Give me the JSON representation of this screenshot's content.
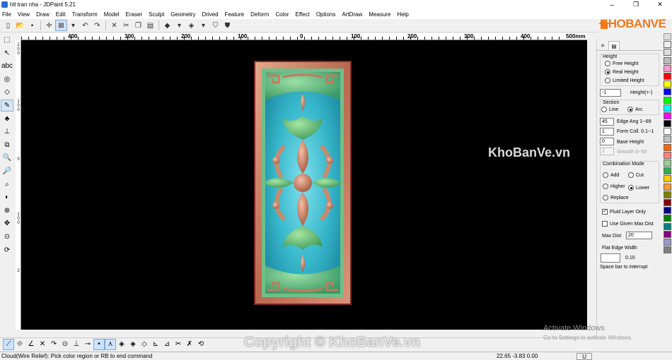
{
  "window": {
    "title": "hlt tran nha - JDPaint 5.21",
    "minimize": "─",
    "restore": "❐",
    "close": "✕"
  },
  "menu": [
    "File",
    "View",
    "Draw",
    "Edit",
    "Transform",
    "Model",
    "Eraser",
    "Sculpt",
    "Geometry",
    "Drived",
    "Feature",
    "Deform",
    "Color",
    "Effect",
    "Options",
    "ArtDraw",
    "Measure",
    "Help"
  ],
  "logo": {
    "text": "KHOBANVE"
  },
  "ruler": {
    "labels": [
      "400",
      "300",
      "200",
      "100",
      "0",
      "100",
      "200",
      "300",
      "400"
    ],
    "unit_label": "500mm"
  },
  "ruler_v": [
    "2",
    "0",
    "0",
    "1",
    "0",
    "0",
    "0",
    "1",
    "0",
    "0",
    "2"
  ],
  "panel": {
    "height_group": "Height",
    "height_options": [
      "Free Height",
      "Real Height",
      "Limited Height"
    ],
    "height_value": "-1",
    "height_label": "Height(+-)",
    "section_group": "Section",
    "section_options": [
      "Line",
      "Arc"
    ],
    "edge_ang_value": "45",
    "edge_ang_label": "Edge Ang 1--89",
    "form_coll_value": "1",
    "form_coll_label": "Form Coll. 0.1--1",
    "base_height_value": "0",
    "base_height_label": "Base Height",
    "smooth_value": "2",
    "smooth_label": "Smooth 0--50",
    "combination_group": "Combination Mode",
    "combination_options": [
      "Add",
      "Cut",
      "Higher",
      "Lower",
      "Replace"
    ],
    "fluid_layer_label": "Fluid Layer Only",
    "use_given_label": "Use Given Max Dist",
    "max_dist_label": "Max Dist",
    "max_dist_value": "20",
    "flat_edge_label": "Flat Edge Width",
    "flat_edge_value": "",
    "flat_edge_unit": "0.10",
    "hint": "Space bar to interrupt"
  },
  "status": {
    "message": "Cloud(Wire Relief): Pick color region or RB to end command",
    "coords": "22.65 -3.83 0.00",
    "mode": "U"
  },
  "watermarks": {
    "center": "KhoBanVe.vn",
    "bottom": "Copyright © KhoBanVe.vn",
    "activate_title": "Activate Windows",
    "activate_sub": "Go to Settings to activate Windows."
  },
  "palette_colors": [
    "#ff99cc",
    "#ff0000",
    "#ffff00",
    "#0000ff",
    "#00ff00",
    "#00ffff",
    "#ff00ff",
    "#000000",
    "#ffffff",
    "#c0c0c0",
    "#ff6600",
    "#ff8080",
    "#99cc99",
    "#33aa55",
    "#ffcc00",
    "#ff9933",
    "#808000",
    "#800000",
    "#000080",
    "#008000",
    "#008080",
    "#800080",
    "#9999cc",
    "#808080"
  ],
  "colors": {
    "canvas": "#000000",
    "accent": "#f07a1a"
  }
}
